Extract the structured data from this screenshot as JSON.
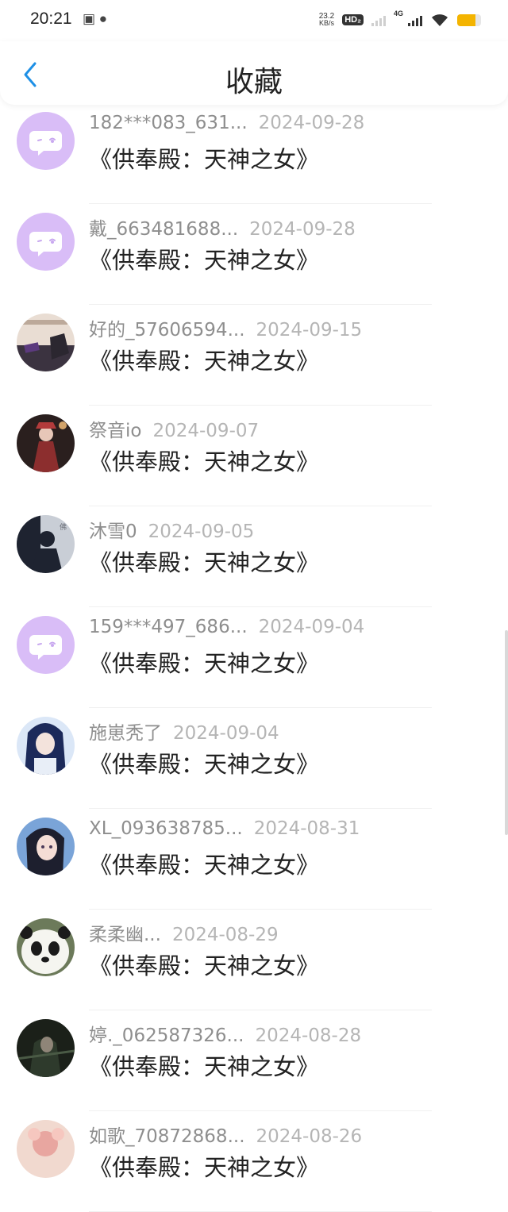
{
  "status": {
    "time": "20:21",
    "net_speed_value": "23.2",
    "net_speed_unit": "KB/s",
    "hd_label": "HD₂",
    "network_type": "4G",
    "battery_level": 0.75
  },
  "header": {
    "title": "收藏"
  },
  "items": [
    {
      "name": "182***083_631...",
      "date": "2024-09-28",
      "book": "《供奉殿：天神之女》",
      "avatar": "default"
    },
    {
      "name": "戴_663481688...",
      "date": "2024-09-28",
      "book": "《供奉殿：天神之女》",
      "avatar": "default"
    },
    {
      "name": "好的_57606594...",
      "date": "2024-09-15",
      "book": "《供奉殿：天神之女》",
      "avatar": "photo-sign"
    },
    {
      "name": "祭音io",
      "date": "2024-09-07",
      "book": "《供奉殿：天神之女》",
      "avatar": "photo-red"
    },
    {
      "name": "沐雪0",
      "date": "2024-09-05",
      "book": "《供奉殿：天神之女》",
      "avatar": "photo-silhouette"
    },
    {
      "name": "159***497_686...",
      "date": "2024-09-04",
      "book": "《供奉殿：天神之女》",
      "avatar": "default"
    },
    {
      "name": "施崽秃了",
      "date": "2024-09-04",
      "book": "《供奉殿：天神之女》",
      "avatar": "photo-anime-blue"
    },
    {
      "name": "XL_093638785...",
      "date": "2024-08-31",
      "book": "《供奉殿：天神之女》",
      "avatar": "photo-anime-girl"
    },
    {
      "name": "柔柔幽...",
      "date": "2024-08-29",
      "book": "《供奉殿：天神之女》",
      "avatar": "photo-panda"
    },
    {
      "name": "婷._062587326...",
      "date": "2024-08-28",
      "book": "《供奉殿：天神之女》",
      "avatar": "photo-dark"
    },
    {
      "name": "如歌_70872868...",
      "date": "2024-08-26",
      "book": "《供奉殿：天神之女》",
      "avatar": "photo-flower"
    }
  ],
  "colors": {
    "default_avatar": "#d9bdf7",
    "back_arrow": "#1e90e6"
  }
}
